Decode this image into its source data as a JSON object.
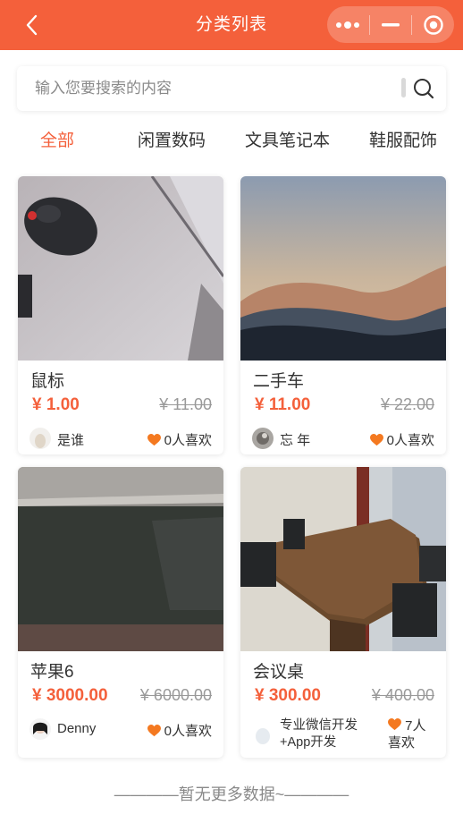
{
  "header": {
    "title": "分类列表",
    "back_icon": "chevron-left-icon",
    "capsule": [
      "more-dots-icon",
      "minimize-icon",
      "record-target-icon"
    ]
  },
  "search": {
    "placeholder": "输入您要搜索的内容",
    "icon": "search-icon"
  },
  "tabs": [
    {
      "label": "全部",
      "active": true
    },
    {
      "label": "闲置数码",
      "active": false
    },
    {
      "label": "文具笔记本",
      "active": false
    },
    {
      "label": "鞋服配饰",
      "active": false
    }
  ],
  "products": [
    {
      "name": "鼠标",
      "price": "¥ 1.00",
      "old_price": "¥ 11.00",
      "seller": "是谁",
      "likes": "0人喜欢",
      "image": "mouse-photo"
    },
    {
      "name": "二手车",
      "price": "¥ 11.00",
      "old_price": "¥ 22.00",
      "seller": "忘 年",
      "likes": "0人喜欢",
      "image": "landscape-photo"
    },
    {
      "name": "苹果6",
      "price": "¥ 3000.00",
      "old_price": "¥ 6000.00",
      "seller": "Denny",
      "likes": "0人喜欢",
      "image": "glass-panel-photo"
    },
    {
      "name": "会议桌",
      "price": "¥ 300.00",
      "old_price": "¥ 400.00",
      "seller": "专业微信开发+App开发",
      "likes": "7人喜欢",
      "image": "meeting-table-photo"
    }
  ],
  "footer": {
    "text": "————暂无更多数据~————"
  },
  "colors": {
    "brand": "#f4603b",
    "price": "#f4603b",
    "heart": "#f47920",
    "muted": "#999999"
  }
}
